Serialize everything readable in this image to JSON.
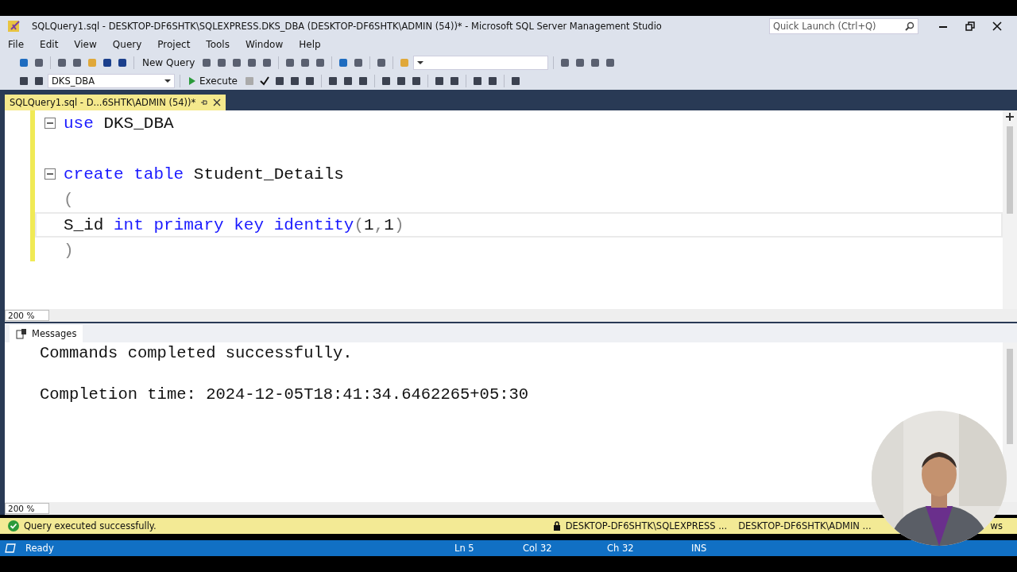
{
  "window": {
    "title": "SQLQuery1.sql - DESKTOP-DF6SHTK\\SQLEXPRESS.DKS_DBA (DESKTOP-DF6SHTK\\ADMIN (54))* - Microsoft SQL Server Management Studio"
  },
  "quick_launch": {
    "placeholder": "Quick Launch (Ctrl+Q)"
  },
  "menu": [
    "File",
    "Edit",
    "View",
    "Query",
    "Project",
    "Tools",
    "Window",
    "Help"
  ],
  "toolbar": {
    "new_query": "New Query",
    "database": "DKS_DBA",
    "execute": "Execute"
  },
  "tabs": [
    {
      "label": "SQLQuery1.sql - D...6SHTK\\ADMIN (54))*",
      "selected": true
    }
  ],
  "editor": {
    "lines": [
      {
        "fold": true,
        "current": false,
        "tokens": [
          {
            "text": "use",
            "kind": "keyword"
          },
          {
            "text": " DKS_DBA",
            "kind": "plain"
          }
        ]
      },
      {
        "fold": false,
        "current": false
      },
      {
        "fold": true,
        "current": false,
        "tokens": [
          {
            "text": "create table",
            "kind": "keyword"
          },
          {
            "text": " Student_Details",
            "kind": "plain"
          }
        ]
      },
      {
        "fold": false,
        "current": false,
        "tokens": [
          {
            "text": "(",
            "kind": "punct"
          }
        ]
      },
      {
        "fold": false,
        "current": true,
        "tokens": [
          {
            "text": "S_id ",
            "kind": "plain"
          },
          {
            "text": "int primary key identity",
            "kind": "keyword"
          },
          {
            "text": "(",
            "kind": "punct"
          },
          {
            "text": "1",
            "kind": "plain"
          },
          {
            "text": ",",
            "kind": "punct"
          },
          {
            "text": "1",
            "kind": "plain"
          },
          {
            "text": ")",
            "kind": "punct"
          }
        ]
      },
      {
        "fold": false,
        "current": false,
        "tokens": [
          {
            "text": ")",
            "kind": "punct"
          }
        ]
      }
    ],
    "zoom": "200 %"
  },
  "results": {
    "tab": "Messages",
    "messages": [
      "Commands completed successfully.",
      "Completion time: 2024-12-05T18:41:34.6462265+05:30"
    ],
    "zoom": "200 %"
  },
  "query_status": {
    "text": "Query executed successfully.",
    "server": "DESKTOP-DF6SHTK\\SQLEXPRESS ...",
    "user": "DESKTOP-DF6SHTK\\ADMIN ...",
    "tail": "ws"
  },
  "status_bar": {
    "state": "Ready",
    "line": "Ln 5",
    "col": "Col 32",
    "ch": "Ch 32",
    "mode": "INS"
  }
}
